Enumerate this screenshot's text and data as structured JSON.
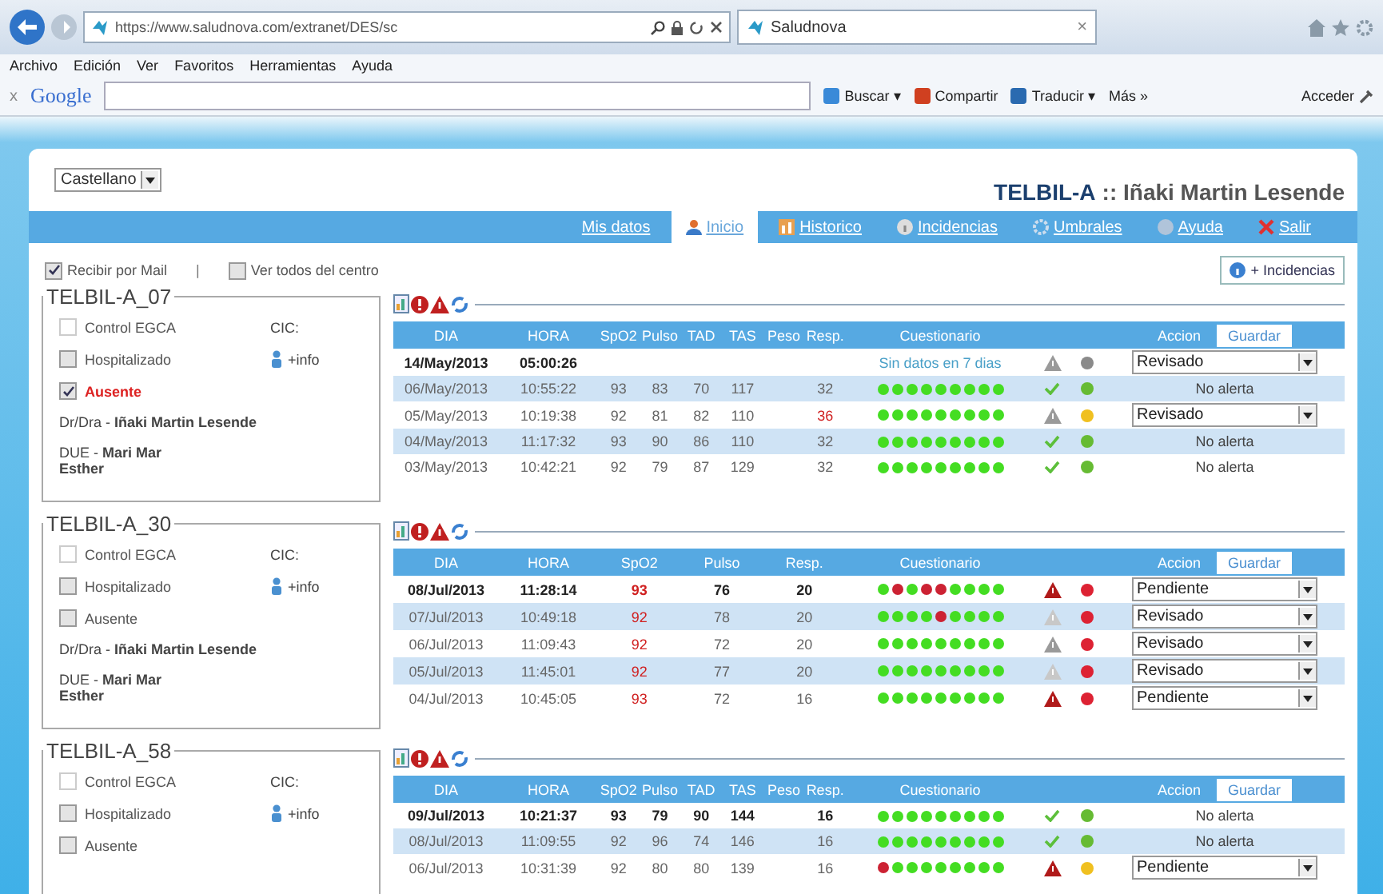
{
  "browser": {
    "url": "https://www.saludnova.com/extranet/DES/sc",
    "tab_title": "Saludnova",
    "tab_close": "×",
    "menu": [
      "Archivo",
      "Edición",
      "Ver",
      "Favoritos",
      "Herramientas",
      "Ayuda"
    ],
    "toolbar": {
      "close": "x",
      "brand": "Google",
      "buttons": [
        "Buscar ▾",
        "Compartir",
        "Traducir ▾",
        "Más »"
      ],
      "sign_in": "Acceder"
    }
  },
  "page": {
    "language": "Castellano",
    "title_code": "TELBIL-A",
    "title_user": ":: Iñaki Martin Lesende",
    "nav": [
      {
        "label": "Mis datos",
        "selected": false
      },
      {
        "label": "Inicio",
        "selected": true
      },
      {
        "label": "Historico",
        "selected": false
      },
      {
        "label": "Incidencias",
        "selected": false
      },
      {
        "label": "Umbrales",
        "selected": false
      },
      {
        "label": "Ayuda",
        "selected": false
      },
      {
        "label": "Salir",
        "selected": false
      }
    ],
    "options": [
      {
        "label": "Recibir por Mail",
        "checked": true
      },
      {
        "label": "Ver todos del centro",
        "checked": false
      }
    ],
    "separator": "|",
    "incidents_button": "+ Incidencias"
  },
  "patients": [
    {
      "code": "TELBIL-A_07",
      "checks": [
        {
          "label": "Control EGCA",
          "checked": false,
          "disabled": true
        },
        {
          "label": "Hospitalizado",
          "checked": false,
          "disabled": false
        },
        {
          "label": "Ausente",
          "checked": true,
          "disabled": false
        }
      ],
      "cic": "CIC:",
      "info": "+info",
      "doctor": "Dr/Dra - **Iñaki Martin Lesende**",
      "nurse": "DUE - **Mari Mar Esther**",
      "columns": [
        {
          "label": "DIA",
          "kind": "date"
        },
        {
          "label": "HORA",
          "kind": "time"
        },
        {
          "label": "SpO2",
          "kind": "reading"
        },
        {
          "label": "Pulso",
          "kind": "reading"
        },
        {
          "label": "TAD",
          "kind": "reading"
        },
        {
          "label": "TAS",
          "kind": "reading"
        },
        {
          "label": "Peso",
          "kind": "blank"
        },
        {
          "label": "Resp.",
          "kind": "reading"
        },
        {
          "label": "Cuestionario",
          "kind": "questionnaire"
        }
      ],
      "action_header": "Accion",
      "save": "Guardar",
      "rows": [
        {
          "date": "14/May/2013",
          "time": "05:00:26",
          "recent": true,
          "note": "Sin datos en 7 dias",
          "indicator": {
            "kind": "warn-grey"
          },
          "status": {
            "color": "#8a8a8a"
          },
          "action": {
            "kind": "select",
            "value": "Revisado"
          }
        },
        {
          "date": "06/May/2013",
          "time": "10:55:22",
          "recent": false,
          "values": [
            {
              "text": "93",
              "alert": false
            },
            {
              "text": "83",
              "alert": false
            },
            {
              "text": "70",
              "alert": false
            },
            {
              "text": "117",
              "alert": false
            },
            {
              "text": "32",
              "alert": false
            }
          ],
          "answers": [
            {
              "color": "#44dd22"
            },
            {
              "color": "#44dd22"
            },
            {
              "color": "#44dd22"
            },
            {
              "color": "#44dd22"
            },
            {
              "color": "#44dd22"
            },
            {
              "color": "#44dd22"
            },
            {
              "color": "#44dd22"
            },
            {
              "color": "#44dd22"
            },
            {
              "color": "#44dd22"
            }
          ],
          "indicator": {
            "kind": "check"
          },
          "status": {
            "color": "#66bb33"
          },
          "action": {
            "kind": "text",
            "value": "No alerta"
          }
        },
        {
          "date": "05/May/2013",
          "time": "10:19:38",
          "recent": false,
          "values": [
            {
              "text": "92",
              "alert": false
            },
            {
              "text": "81",
              "alert": false
            },
            {
              "text": "82",
              "alert": false
            },
            {
              "text": "110",
              "alert": false
            },
            {
              "text": "36",
              "alert": true
            }
          ],
          "answers": [
            {
              "color": "#44dd22"
            },
            {
              "color": "#44dd22"
            },
            {
              "color": "#44dd22"
            },
            {
              "color": "#44dd22"
            },
            {
              "color": "#44dd22"
            },
            {
              "color": "#44dd22"
            },
            {
              "color": "#44dd22"
            },
            {
              "color": "#44dd22"
            },
            {
              "color": "#44dd22"
            }
          ],
          "indicator": {
            "kind": "warn-grey"
          },
          "status": {
            "color": "#f0c020"
          },
          "action": {
            "kind": "select",
            "value": "Revisado"
          }
        },
        {
          "date": "04/May/2013",
          "time": "11:17:32",
          "recent": false,
          "values": [
            {
              "text": "93",
              "alert": false
            },
            {
              "text": "90",
              "alert": false
            },
            {
              "text": "86",
              "alert": false
            },
            {
              "text": "110",
              "alert": false
            },
            {
              "text": "32",
              "alert": false
            }
          ],
          "answers": [
            {
              "color": "#44dd22"
            },
            {
              "color": "#44dd22"
            },
            {
              "color": "#44dd22"
            },
            {
              "color": "#44dd22"
            },
            {
              "color": "#44dd22"
            },
            {
              "color": "#44dd22"
            },
            {
              "color": "#44dd22"
            },
            {
              "color": "#44dd22"
            },
            {
              "color": "#44dd22"
            }
          ],
          "indicator": {
            "kind": "check"
          },
          "status": {
            "color": "#66bb33"
          },
          "action": {
            "kind": "text",
            "value": "No alerta"
          }
        },
        {
          "date": "03/May/2013",
          "time": "10:42:21",
          "recent": false,
          "values": [
            {
              "text": "92",
              "alert": false
            },
            {
              "text": "79",
              "alert": false
            },
            {
              "text": "87",
              "alert": false
            },
            {
              "text": "129",
              "alert": false
            },
            {
              "text": "32",
              "alert": false
            }
          ],
          "answers": [
            {
              "color": "#44dd22"
            },
            {
              "color": "#44dd22"
            },
            {
              "color": "#44dd22"
            },
            {
              "color": "#44dd22"
            },
            {
              "color": "#44dd22"
            },
            {
              "color": "#44dd22"
            },
            {
              "color": "#44dd22"
            },
            {
              "color": "#44dd22"
            },
            {
              "color": "#44dd22"
            }
          ],
          "indicator": {
            "kind": "check"
          },
          "status": {
            "color": "#66bb33"
          },
          "action": {
            "kind": "text",
            "value": "No alerta"
          }
        }
      ]
    },
    {
      "code": "TELBIL-A_30",
      "checks": [
        {
          "label": "Control EGCA",
          "checked": false,
          "disabled": true
        },
        {
          "label": "Hospitalizado",
          "checked": false,
          "disabled": false
        },
        {
          "label": "Ausente",
          "checked": false,
          "disabled": false
        }
      ],
      "cic": "CIC:",
      "info": "+info",
      "doctor": "Dr/Dra - **Iñaki Martin Lesende**",
      "nurse": "DUE - **Mari Mar Esther**",
      "columns": [
        {
          "label": "DIA",
          "kind": "date"
        },
        {
          "label": "HORA",
          "kind": "time"
        },
        {
          "label": "SpO2",
          "kind": "reading"
        },
        {
          "label": "Pulso",
          "kind": "reading"
        },
        {
          "label": "Resp.",
          "kind": "reading"
        },
        {
          "label": "Cuestionario",
          "kind": "questionnaire"
        }
      ],
      "action_header": "Accion",
      "save": "Guardar",
      "rows": [
        {
          "date": "08/Jul/2013",
          "time": "11:28:14",
          "recent": true,
          "values": [
            {
              "text": "93",
              "alert": true
            },
            {
              "text": "76",
              "alert": false
            },
            {
              "text": "20",
              "alert": false
            }
          ],
          "answers": [
            {
              "color": "#44dd22"
            },
            {
              "color": "#cc2233"
            },
            {
              "color": "#44dd22"
            },
            {
              "color": "#cc2233"
            },
            {
              "color": "#cc2233"
            },
            {
              "color": "#44dd22"
            },
            {
              "color": "#44dd22"
            },
            {
              "color": "#44dd22"
            },
            {
              "color": "#44dd22"
            }
          ],
          "indicator": {
            "kind": "warn-red"
          },
          "status": {
            "color": "#dd2233"
          },
          "action": {
            "kind": "select",
            "value": "Pendiente"
          }
        },
        {
          "date": "07/Jul/2013",
          "time": "10:49:18",
          "recent": false,
          "values": [
            {
              "text": "92",
              "alert": true
            },
            {
              "text": "78",
              "alert": false
            },
            {
              "text": "20",
              "alert": false
            }
          ],
          "answers": [
            {
              "color": "#44dd22"
            },
            {
              "color": "#44dd22"
            },
            {
              "color": "#44dd22"
            },
            {
              "color": "#44dd22"
            },
            {
              "color": "#cc2233"
            },
            {
              "color": "#44dd22"
            },
            {
              "color": "#44dd22"
            },
            {
              "color": "#44dd22"
            },
            {
              "color": "#44dd22"
            }
          ],
          "indicator": {
            "kind": "warn-faint"
          },
          "status": {
            "color": "#dd2233"
          },
          "action": {
            "kind": "select",
            "value": "Revisado"
          }
        },
        {
          "date": "06/Jul/2013",
          "time": "11:09:43",
          "recent": false,
          "values": [
            {
              "text": "92",
              "alert": true
            },
            {
              "text": "72",
              "alert": false
            },
            {
              "text": "20",
              "alert": false
            }
          ],
          "answers": [
            {
              "color": "#44dd22"
            },
            {
              "color": "#44dd22"
            },
            {
              "color": "#44dd22"
            },
            {
              "color": "#44dd22"
            },
            {
              "color": "#44dd22"
            },
            {
              "color": "#44dd22"
            },
            {
              "color": "#44dd22"
            },
            {
              "color": "#44dd22"
            },
            {
              "color": "#44dd22"
            }
          ],
          "indicator": {
            "kind": "warn-grey"
          },
          "status": {
            "color": "#dd2233"
          },
          "action": {
            "kind": "select",
            "value": "Revisado"
          }
        },
        {
          "date": "05/Jul/2013",
          "time": "11:45:01",
          "recent": false,
          "values": [
            {
              "text": "92",
              "alert": true
            },
            {
              "text": "77",
              "alert": false
            },
            {
              "text": "20",
              "alert": false
            }
          ],
          "answers": [
            {
              "color": "#44dd22"
            },
            {
              "color": "#44dd22"
            },
            {
              "color": "#44dd22"
            },
            {
              "color": "#44dd22"
            },
            {
              "color": "#44dd22"
            },
            {
              "color": "#44dd22"
            },
            {
              "color": "#44dd22"
            },
            {
              "color": "#44dd22"
            },
            {
              "color": "#44dd22"
            }
          ],
          "indicator": {
            "kind": "warn-faint"
          },
          "status": {
            "color": "#dd2233"
          },
          "action": {
            "kind": "select",
            "value": "Revisado"
          }
        },
        {
          "date": "04/Jul/2013",
          "time": "10:45:05",
          "recent": false,
          "values": [
            {
              "text": "93",
              "alert": true
            },
            {
              "text": "72",
              "alert": false
            },
            {
              "text": "16",
              "alert": false
            }
          ],
          "answers": [
            {
              "color": "#44dd22"
            },
            {
              "color": "#44dd22"
            },
            {
              "color": "#44dd22"
            },
            {
              "color": "#44dd22"
            },
            {
              "color": "#44dd22"
            },
            {
              "color": "#44dd22"
            },
            {
              "color": "#44dd22"
            },
            {
              "color": "#44dd22"
            },
            {
              "color": "#44dd22"
            }
          ],
          "indicator": {
            "kind": "warn-red"
          },
          "status": {
            "color": "#dd2233"
          },
          "action": {
            "kind": "select",
            "value": "Pendiente"
          }
        }
      ]
    },
    {
      "code": "TELBIL-A_58",
      "checks": [
        {
          "label": "Control EGCA",
          "checked": false,
          "disabled": true
        },
        {
          "label": "Hospitalizado",
          "checked": false,
          "disabled": false
        },
        {
          "label": "Ausente",
          "checked": false,
          "disabled": false
        }
      ],
      "cic": "CIC:",
      "info": "+info",
      "columns": [
        {
          "label": "DIA",
          "kind": "date"
        },
        {
          "label": "HORA",
          "kind": "time"
        },
        {
          "label": "SpO2",
          "kind": "reading"
        },
        {
          "label": "Pulso",
          "kind": "reading"
        },
        {
          "label": "TAD",
          "kind": "reading"
        },
        {
          "label": "TAS",
          "kind": "reading"
        },
        {
          "label": "Peso",
          "kind": "blank"
        },
        {
          "label": "Resp.",
          "kind": "reading"
        },
        {
          "label": "Cuestionario",
          "kind": "questionnaire"
        }
      ],
      "action_header": "Accion",
      "save": "Guardar",
      "rows": [
        {
          "date": "09/Jul/2013",
          "time": "10:21:37",
          "recent": true,
          "values": [
            {
              "text": "93",
              "alert": false
            },
            {
              "text": "79",
              "alert": false
            },
            {
              "text": "90",
              "alert": false
            },
            {
              "text": "144",
              "alert": false
            },
            {
              "text": "16",
              "alert": false
            }
          ],
          "answers": [
            {
              "color": "#44dd22"
            },
            {
              "color": "#44dd22"
            },
            {
              "color": "#44dd22"
            },
            {
              "color": "#44dd22"
            },
            {
              "color": "#44dd22"
            },
            {
              "color": "#44dd22"
            },
            {
              "color": "#44dd22"
            },
            {
              "color": "#44dd22"
            },
            {
              "color": "#44dd22"
            }
          ],
          "indicator": {
            "kind": "check"
          },
          "status": {
            "color": "#66bb33"
          },
          "action": {
            "kind": "text",
            "value": "No alerta"
          }
        },
        {
          "date": "08/Jul/2013",
          "time": "11:09:55",
          "recent": false,
          "values": [
            {
              "text": "92",
              "alert": false
            },
            {
              "text": "96",
              "alert": false
            },
            {
              "text": "74",
              "alert": false
            },
            {
              "text": "146",
              "alert": false
            },
            {
              "text": "16",
              "alert": false
            }
          ],
          "answers": [
            {
              "color": "#44dd22"
            },
            {
              "color": "#44dd22"
            },
            {
              "color": "#44dd22"
            },
            {
              "color": "#44dd22"
            },
            {
              "color": "#44dd22"
            },
            {
              "color": "#44dd22"
            },
            {
              "color": "#44dd22"
            },
            {
              "color": "#44dd22"
            },
            {
              "color": "#44dd22"
            }
          ],
          "indicator": {
            "kind": "check"
          },
          "status": {
            "color": "#66bb33"
          },
          "action": {
            "kind": "text",
            "value": "No alerta"
          }
        },
        {
          "date": "06/Jul/2013",
          "time": "10:31:39",
          "recent": false,
          "values": [
            {
              "text": "92",
              "alert": false
            },
            {
              "text": "80",
              "alert": false
            },
            {
              "text": "80",
              "alert": false
            },
            {
              "text": "139",
              "alert": false
            },
            {
              "text": "16",
              "alert": false
            }
          ],
          "answers": [
            {
              "color": "#cc2233"
            },
            {
              "color": "#44dd22"
            },
            {
              "color": "#44dd22"
            },
            {
              "color": "#44dd22"
            },
            {
              "color": "#44dd22"
            },
            {
              "color": "#44dd22"
            },
            {
              "color": "#44dd22"
            },
            {
              "color": "#44dd22"
            },
            {
              "color": "#44dd22"
            }
          ],
          "indicator": {
            "kind": "warn-red"
          },
          "status": {
            "color": "#f0c020"
          },
          "action": {
            "kind": "select",
            "value": "Pendiente"
          }
        }
      ]
    }
  ]
}
